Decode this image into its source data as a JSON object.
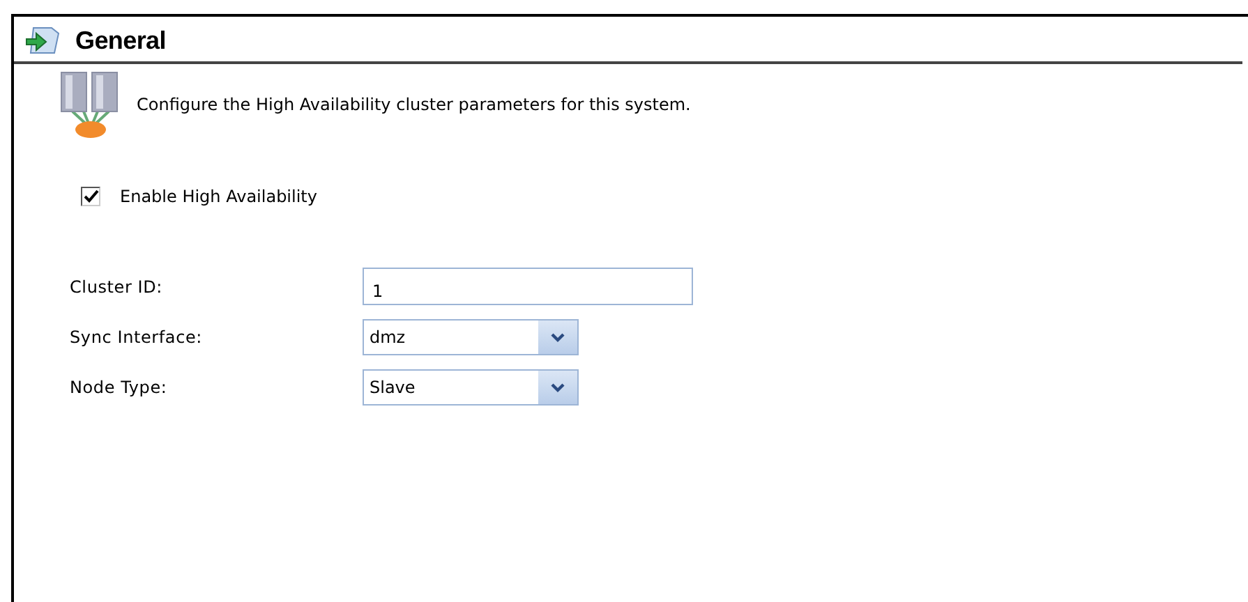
{
  "section": {
    "title": "General"
  },
  "description": "Configure the High Availability cluster parameters for this system.",
  "enable": {
    "label": "Enable High Availability",
    "checked": true
  },
  "fields": [
    {
      "kind": "text",
      "label": "Cluster ID:",
      "value": "1"
    },
    {
      "kind": "select",
      "label": "Sync Interface:",
      "value": "dmz"
    },
    {
      "kind": "select",
      "label": "Node Type:",
      "value": "Slave"
    }
  ]
}
